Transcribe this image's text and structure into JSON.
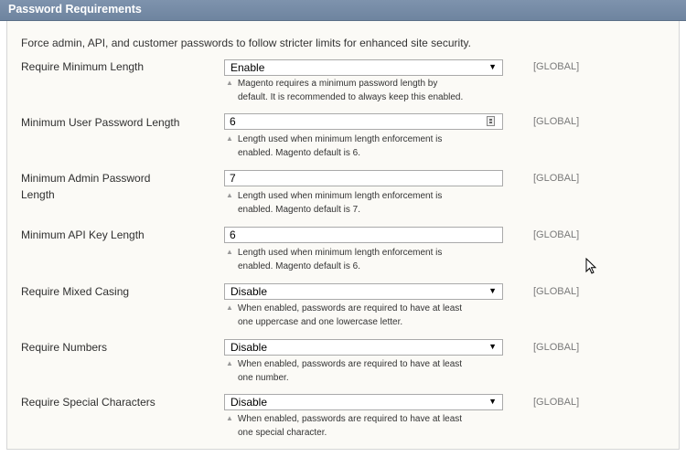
{
  "section": {
    "title": "Password Requirements"
  },
  "intro": "Force admin, API, and customer passwords to follow stricter limits for enhanced site security.",
  "rows": [
    {
      "label": "Require Minimum Length",
      "type": "select",
      "value": "Enable",
      "note1": "Magento requires a minimum password length by",
      "note2": "default. It is recommended to always keep this enabled.",
      "scope": "[GLOBAL]"
    },
    {
      "label": "Minimum User Password Length",
      "type": "input",
      "value": "6",
      "note1": "Length used when minimum length enforcement is",
      "note2": "enabled. Magento default is 6.",
      "scope": "[GLOBAL]"
    },
    {
      "label": "Minimum Admin Password Length",
      "type": "input",
      "value": "7",
      "note1": "Length used when minimum length enforcement is",
      "note2": "enabled. Magento default is 7.",
      "scope": "[GLOBAL]"
    },
    {
      "label": "Minimum API Key Length",
      "type": "input",
      "value": "6",
      "note1": "Length used when minimum length enforcement is",
      "note2": "enabled. Magento default is 6.",
      "scope": "[GLOBAL]"
    },
    {
      "label": "Require Mixed Casing",
      "type": "select",
      "value": "Disable",
      "note1": "When enabled, passwords are required to have at least",
      "note2": "one uppercase and one lowercase letter.",
      "scope": "[GLOBAL]"
    },
    {
      "label": "Require Numbers",
      "type": "select",
      "value": "Disable",
      "note1": "When enabled, passwords are required to have at least",
      "note2": "one number.",
      "scope": "[GLOBAL]"
    },
    {
      "label": "Require Special Characters",
      "type": "select",
      "value": "Disable",
      "note1": "When enabled, passwords are required to have at least",
      "note2": "one special character.",
      "scope": "[GLOBAL]"
    }
  ]
}
